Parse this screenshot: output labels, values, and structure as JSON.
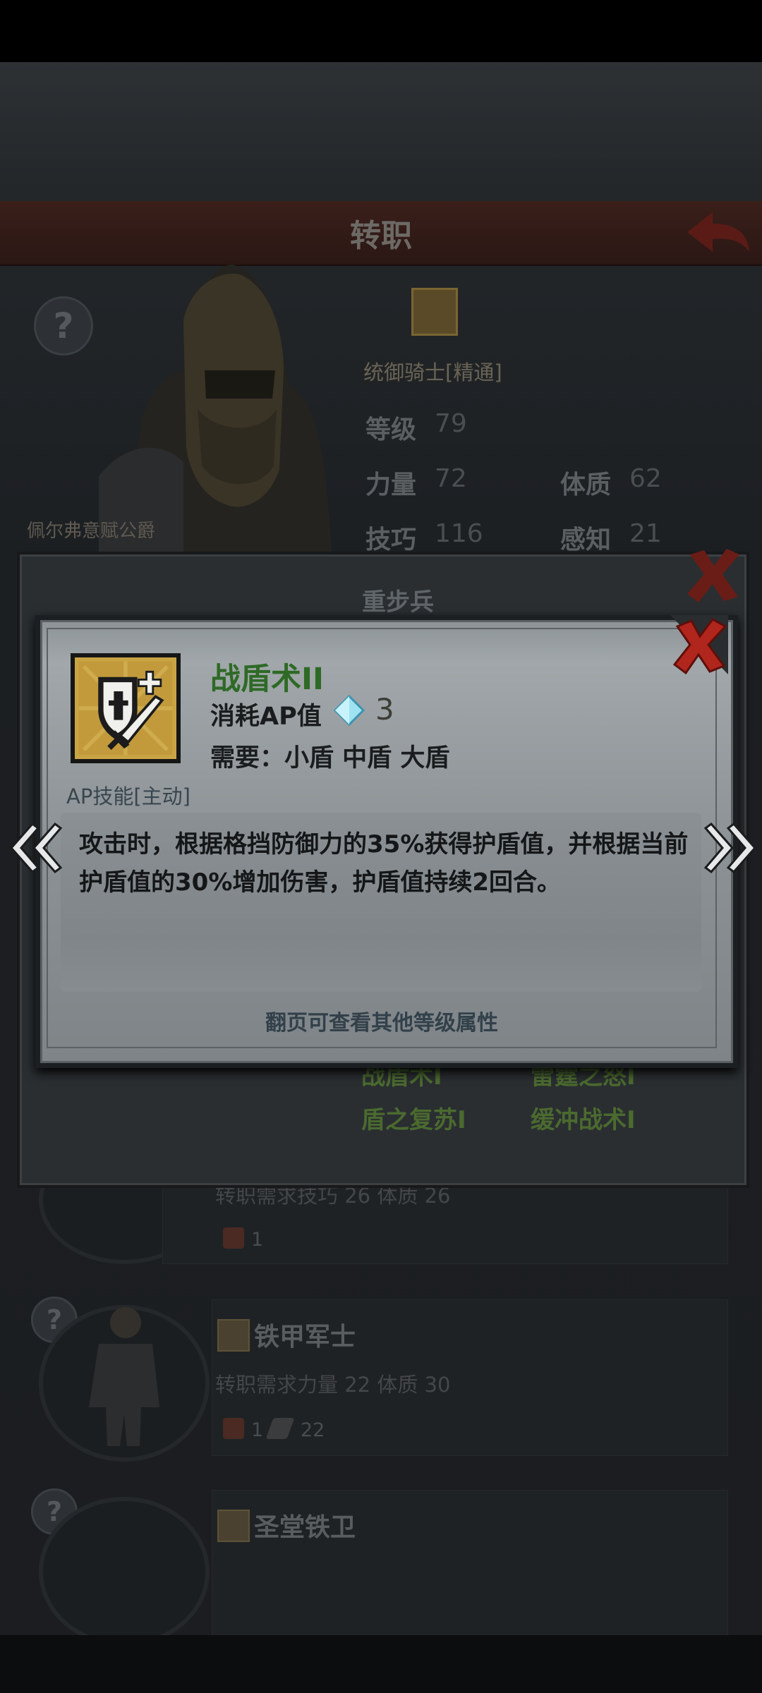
{
  "screen": {
    "title": "转职",
    "help_glyph": "?"
  },
  "hero": {
    "name": "佩尔弗意赋公爵",
    "class_name": "统御骑士[精通]",
    "stats": [
      {
        "label": "等级",
        "value": "79"
      },
      {
        "label": "力量",
        "value": "72"
      },
      {
        "label": "体质",
        "value": "62"
      },
      {
        "label": "技巧",
        "value": "116"
      },
      {
        "label": "感知",
        "value": "21"
      }
    ]
  },
  "back_popup": {
    "title": "重步兵",
    "skills": [
      "战盾术I",
      "雷霆之怒I",
      "盾之复苏I",
      "缓冲战术I"
    ]
  },
  "list_items": [
    {
      "requirement": "转职需求技巧 26 体质 26",
      "cost1": "1",
      "cost2": ""
    },
    {
      "name": "铁甲军士",
      "requirement": "转职需求力量 22 体质 30",
      "cost1": "1",
      "cost2": "22"
    },
    {
      "name": "圣堂铁卫",
      "requirement": "",
      "cost1": "",
      "cost2": ""
    }
  ],
  "skill_popup": {
    "name": "战盾术II",
    "ap_cost_label": "消耗AP值",
    "ap_cost_value": "3",
    "requirement": "需要：小盾 中盾 大盾",
    "type": "AP技能[主动]",
    "description": "攻击时，根据格挡防御力的35%获得护盾值，并根据当前护盾值的30%增加伤害，护盾值持续2回合。",
    "page_hint": "翻页可查看其他等级属性"
  },
  "colors": {
    "skill_name": "#2e6a26",
    "popup_bg": "#9aa0a3",
    "close_red": "#b0261c"
  },
  "icons": {
    "close": "close-icon",
    "prev": "chevron-double-left-icon",
    "next": "chevron-double-right-icon",
    "skill": "shield-sword-icon",
    "ap": "diamond-icon",
    "back": "back-arrow-icon"
  }
}
